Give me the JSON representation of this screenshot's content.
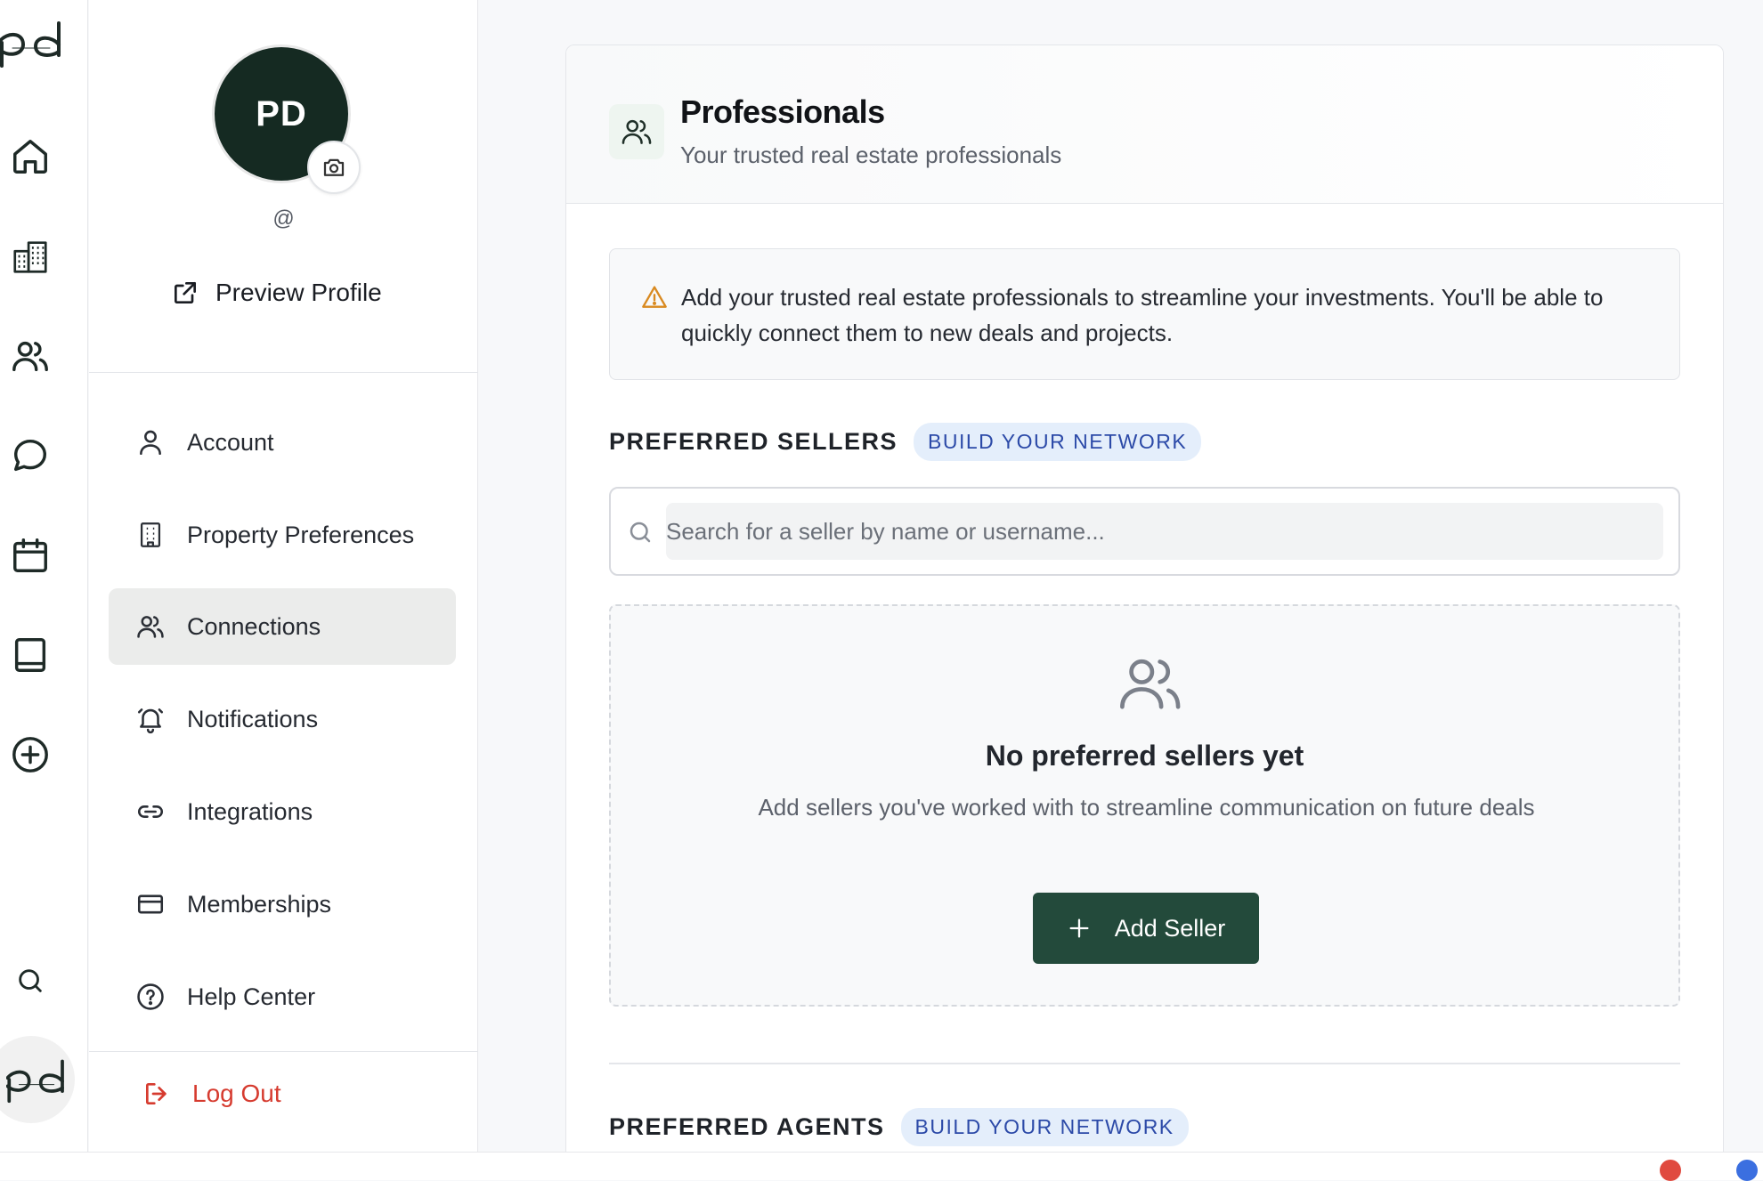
{
  "rail": {
    "logo_icon": "pd-logo-icon",
    "items": [
      {
        "icon": "home-icon"
      },
      {
        "icon": "buildings-icon"
      },
      {
        "icon": "users-icon"
      },
      {
        "icon": "chat-icon"
      },
      {
        "icon": "calendar-icon"
      },
      {
        "icon": "book-icon"
      },
      {
        "icon": "plus-circle-icon"
      },
      {
        "icon": "search-icon"
      }
    ]
  },
  "profile": {
    "initials": "PD",
    "handle": "@",
    "preview_label": "Preview Profile"
  },
  "nav": {
    "items": [
      {
        "label": "Account",
        "icon": "user-icon"
      },
      {
        "label": "Property Preferences",
        "icon": "building-icon"
      },
      {
        "label": "Connections",
        "icon": "users-icon",
        "active": true
      },
      {
        "label": "Notifications",
        "icon": "bell-icon"
      },
      {
        "label": "Integrations",
        "icon": "link-icon"
      },
      {
        "label": "Memberships",
        "icon": "credit-card-icon"
      },
      {
        "label": "Help Center",
        "icon": "help-circle-icon"
      }
    ],
    "logout_label": "Log Out"
  },
  "main": {
    "title": "Professionals",
    "subtitle": "Your trusted real estate professionals",
    "info_text": "Add your trusted real estate professionals to streamline your investments. You'll be able to quickly connect them to new deals and projects.",
    "sellers": {
      "title": "PREFERRED SELLERS",
      "badge": "BUILD YOUR NETWORK",
      "search_placeholder": "Search for a seller by name or username...",
      "empty_title": "No preferred sellers yet",
      "empty_text": "Add sellers you've worked with to streamline communication on future deals",
      "add_label": "Add Seller"
    },
    "agents": {
      "title": "PREFERRED AGENTS",
      "badge": "BUILD YOUR NETWORK"
    }
  },
  "colors": {
    "brand_dark": "#152a22",
    "button_green": "#234a3b",
    "logout_red": "#d63b2f",
    "badge_blue": "#2c4aa8",
    "warning": "#d98a20"
  }
}
